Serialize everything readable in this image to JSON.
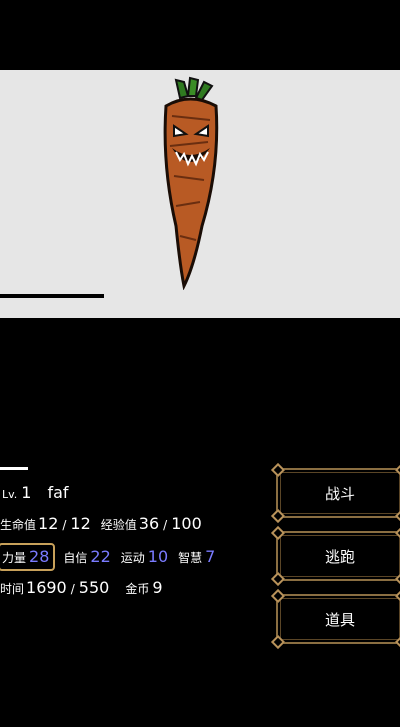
{
  "enemy": {
    "hp_fraction": 0.26
  },
  "player": {
    "hp_fraction": 0.07,
    "level_label": "Lv.",
    "level": "1",
    "name": "faf",
    "hp_label": "生命值",
    "hp": "12",
    "hp_max": "12",
    "exp_label": "经验值",
    "exp": "36",
    "exp_max": "100",
    "strength_label": "力量",
    "strength": "28",
    "confidence_label": "自信",
    "confidence": "22",
    "sport_label": "运动",
    "sport": "10",
    "wisdom_label": "智慧",
    "wisdom": "7",
    "time_label": "时间",
    "time": "1690",
    "time_max": "550",
    "gold_label": "金币",
    "gold": "9"
  },
  "actions": {
    "fight": "战斗",
    "flee": "逃跑",
    "items": "道具"
  },
  "colors": {
    "stat_value_blue": "#7a7bff",
    "button_border": "#8b6f42",
    "strength_highlight": "#c8a15a",
    "enemy_panel_bg": "#e6e6e6"
  }
}
